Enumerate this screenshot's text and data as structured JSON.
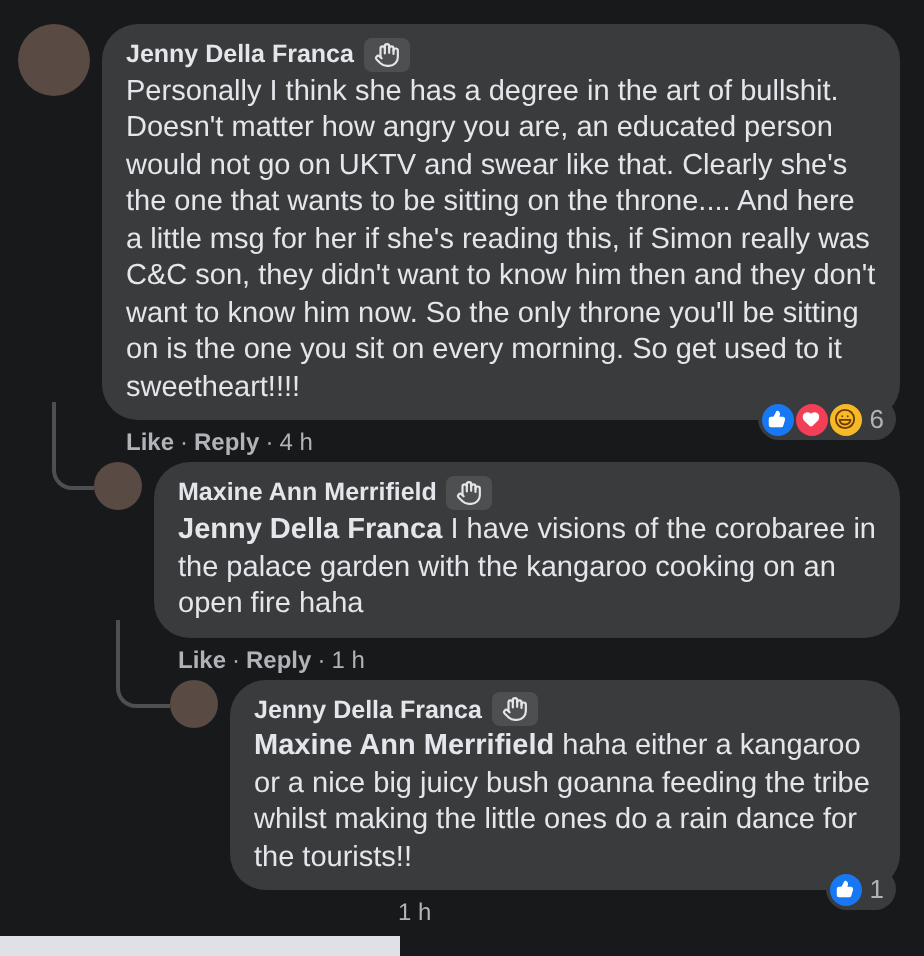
{
  "comments": [
    {
      "author": "Jenny Della Franca",
      "body": "Personally I think she has a degree in the art of bullshit. Doesn't matter how angry you are, an educated person would not go on UKTV and swear like that. Clearly she's the one that wants to be sitting on the throne.... And here a little msg for her if she's reading this, if Simon really was C&C son, they didn't want to know him then and they don't want to know him now. So the only throne you'll be sitting on is the one you sit on every morning. So get used to it sweetheart!!!!",
      "like": "Like",
      "reply": "Reply",
      "separator": "·",
      "time": "4 h",
      "reactions": [
        {
          "kind": "like"
        },
        {
          "kind": "love"
        },
        {
          "kind": "haha"
        }
      ],
      "reaction_count": "6",
      "replies": [
        {
          "author": "Maxine Ann Merrifield",
          "body": "**Jenny Della Franca** I have visions of the corobaree in the palace garden with the kangaroo cooking on an open fire haha",
          "like": "Like",
          "reply": "Reply",
          "separator": "·",
          "time": "1 h",
          "replies": [
            {
              "author": "Jenny Della Franca",
              "body": "**Maxine Ann Merrifield** haha either a kangaroo or a nice big juicy bush goanna feeding the tribe whilst making the little ones do a rain dance for the tourists!!",
              "time": "1 h",
              "reactions": [
                {
                  "kind": "like"
                }
              ],
              "reaction_count": "1"
            }
          ]
        }
      ]
    }
  ]
}
